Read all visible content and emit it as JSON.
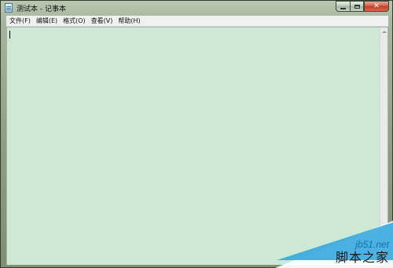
{
  "window": {
    "title": "测试本 - 记事本",
    "close_glyph": "✕"
  },
  "menubar": {
    "items": [
      {
        "label": "文件(F)"
      },
      {
        "label": "编辑(E)"
      },
      {
        "label": "格式(O)"
      },
      {
        "label": "查看(V)"
      },
      {
        "label": "帮助(H)"
      }
    ]
  },
  "editor": {
    "content": "",
    "background_color": "#cde8d4"
  },
  "watermark": {
    "url": "jb51.net",
    "name": "脚本之家",
    "accent_color": "#2ba3dd"
  }
}
